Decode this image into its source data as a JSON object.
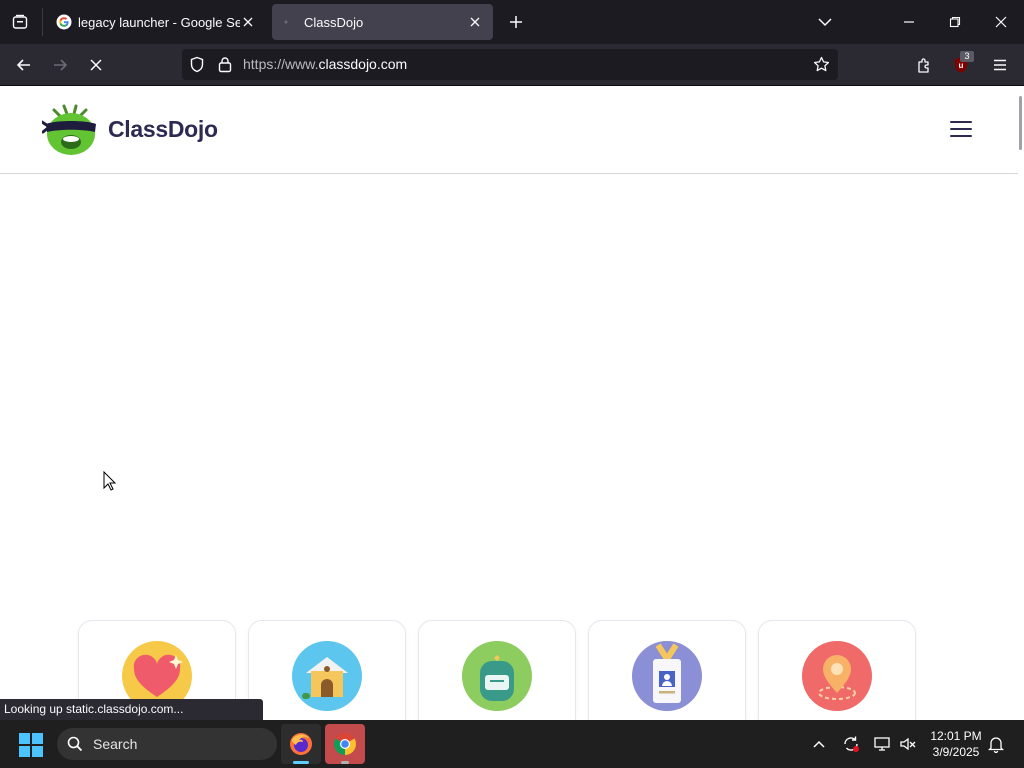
{
  "browser": {
    "tabs": [
      {
        "title": "legacy launcher - Google Search",
        "favicon": "google-icon",
        "active": false
      },
      {
        "title": "ClassDojo",
        "favicon": "loading-dot-icon",
        "active": true
      }
    ],
    "url": {
      "prefix": "https://www.",
      "host": "classdojo.com"
    },
    "extension_badge": "3",
    "status_text": "Looking up static.classdojo.com..."
  },
  "site": {
    "brand": "ClassDojo",
    "cards": [
      {
        "icon": "heart-icon",
        "color": "#f7c948"
      },
      {
        "icon": "school-house-icon",
        "color": "#5cc6ef"
      },
      {
        "icon": "backpack-icon",
        "color": "#8dcc5f"
      },
      {
        "icon": "id-badge-icon",
        "color": "#8a8fd6"
      },
      {
        "icon": "location-pin-icon",
        "color": "#f06a6a"
      }
    ]
  },
  "taskbar": {
    "search_label": "Search",
    "time": "12:01 PM",
    "date": "3/9/2025"
  }
}
